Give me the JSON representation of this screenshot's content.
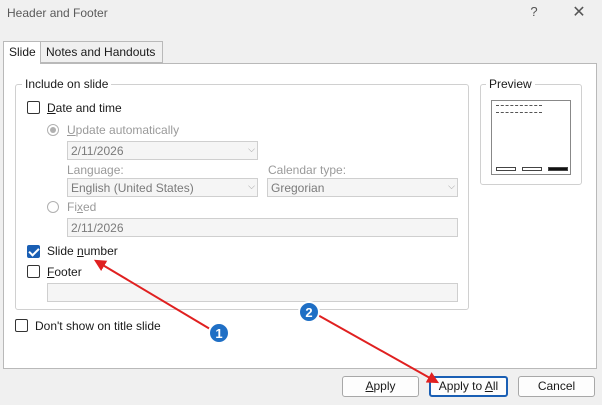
{
  "window": {
    "title": "Header and Footer",
    "help_glyph": "?",
    "close_glyph": "✕"
  },
  "tabs": [
    {
      "label": "Slide",
      "active": true
    },
    {
      "label": "Notes and Handouts",
      "active": false
    }
  ],
  "include_group": {
    "legend": "Include on slide",
    "date_time": {
      "label_pre": "",
      "label_u": "D",
      "label_post": "ate and time",
      "checked": false
    },
    "update_auto": {
      "label_pre": "",
      "label_u": "U",
      "label_post": "pdate automatically",
      "selected": true
    },
    "date_value": "2/11/2026",
    "language_label": "Language:",
    "language_value": "English (United States)",
    "calendar_label": "Calendar type:",
    "calendar_value": "Gregorian",
    "fixed": {
      "label_pre": "Fi",
      "label_u": "x",
      "label_post": "ed",
      "selected": false
    },
    "fixed_value": "2/11/2026",
    "slide_number": {
      "label_pre": "Slide ",
      "label_u": "n",
      "label_post": "umber",
      "checked": true
    },
    "footer": {
      "label_pre": "",
      "label_u": "F",
      "label_post": "ooter",
      "checked": false
    },
    "footer_value": ""
  },
  "dont_show_title": {
    "label": "Don't show on title slide",
    "checked": false
  },
  "preview": {
    "legend": "Preview"
  },
  "buttons": {
    "apply": {
      "label_pre": "",
      "label_u": "A",
      "label_post": "pply"
    },
    "apply_all": {
      "label_pre": "Apply to ",
      "label_u": "A",
      "label_post": "ll"
    },
    "cancel": "Cancel"
  },
  "annotations": {
    "marker1": "1",
    "marker2": "2",
    "color": "#e02020",
    "badge_color": "#1f6fc5"
  }
}
